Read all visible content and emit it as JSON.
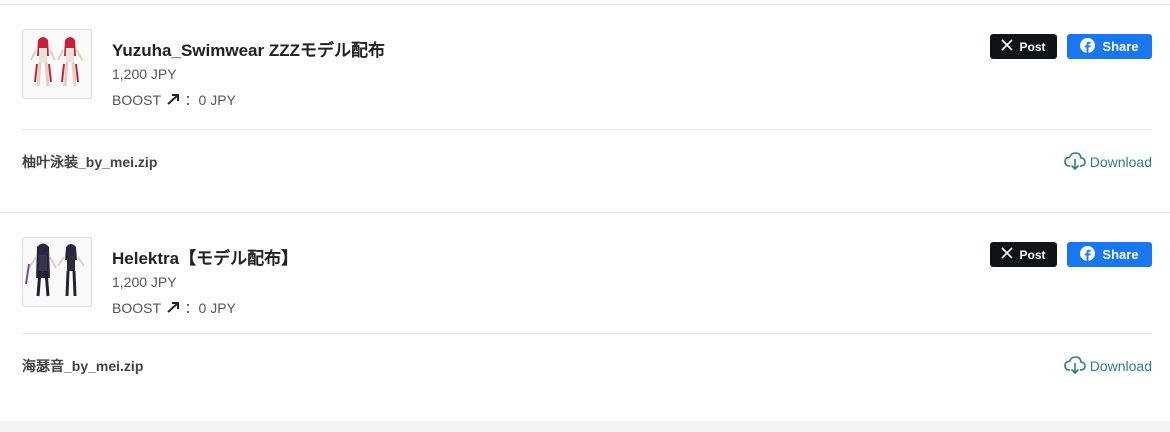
{
  "items": [
    {
      "title": "Yuzuha_Swimwear ZZZモデル配布",
      "price": "1,200 JPY",
      "boost_label": "BOOST",
      "boost_value": "：0 JPY",
      "x_post_label": "Post",
      "fb_share_label": "Share",
      "file_name": "柚叶泳装_by_mei.zip",
      "download_label": "Download"
    },
    {
      "title": "Helektra【モデル配布】",
      "price": "1,200 JPY",
      "boost_label": "BOOST",
      "boost_value": "：0 JPY",
      "x_post_label": "Post",
      "fb_share_label": "Share",
      "file_name": "海瑟音_by_mei.zip",
      "download_label": "Download"
    }
  ],
  "colors": {
    "x_button": "#0f1419",
    "facebook_button": "#1877f2",
    "download_link": "#2e7d8c",
    "page_background": "#f2f4f6"
  },
  "icons": {
    "boost_arrow": "arrow-up-right-icon",
    "x_logo": "x-logo-icon",
    "facebook_logo": "facebook-logo-icon",
    "download": "cloud-download-icon"
  }
}
